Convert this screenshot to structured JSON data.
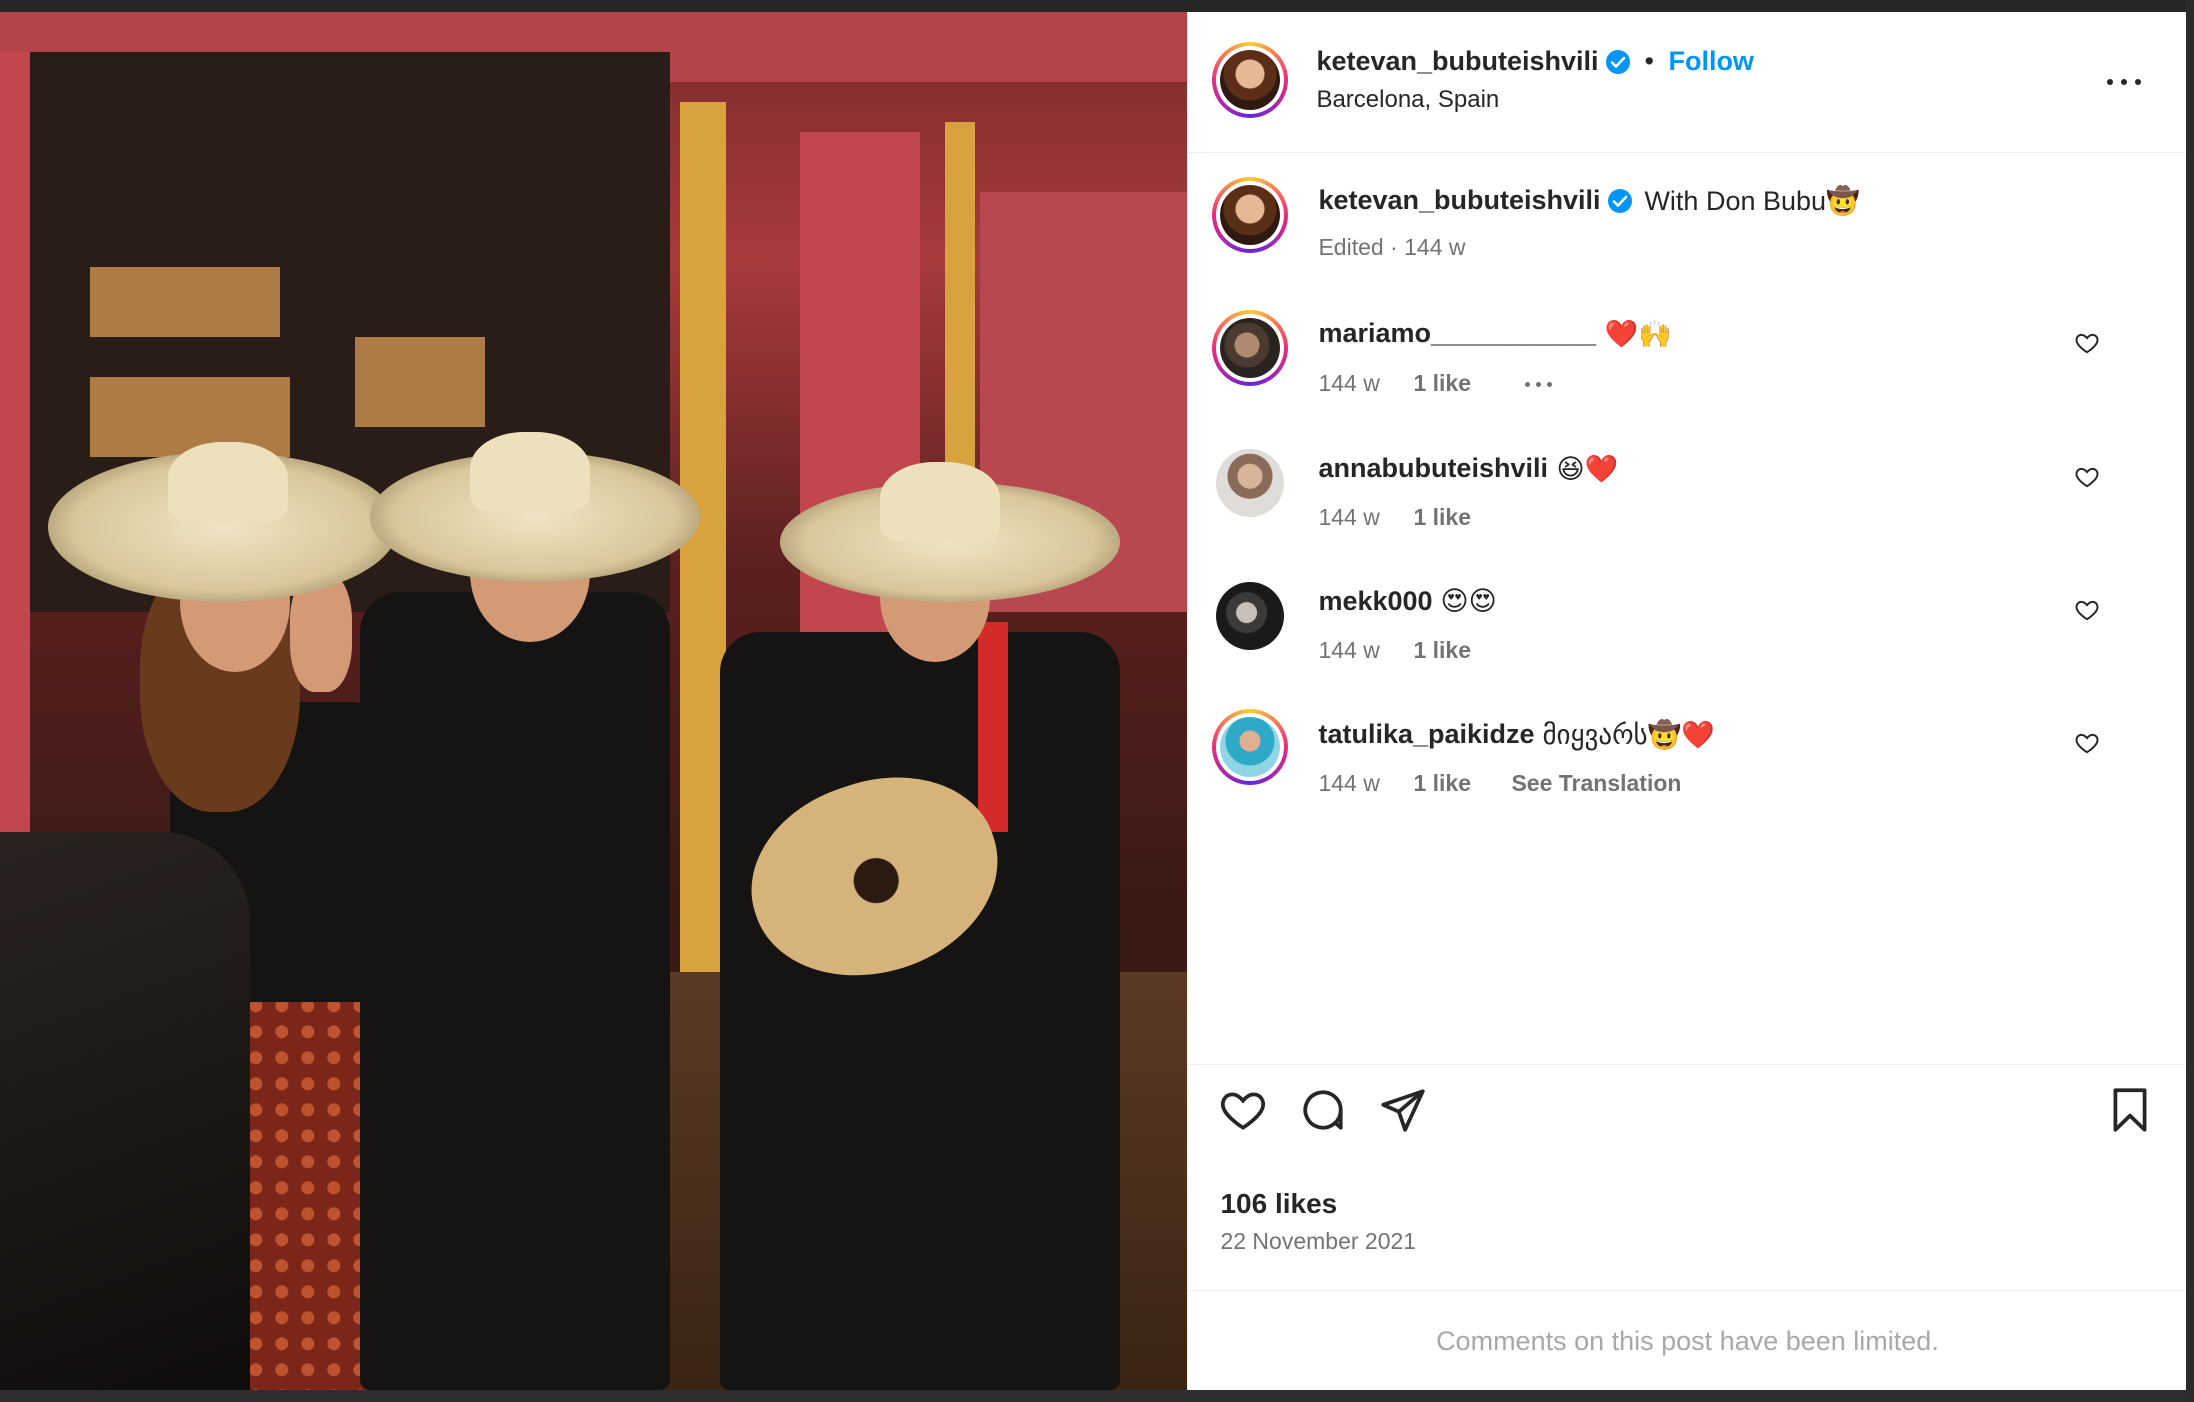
{
  "post": {
    "author": "ketevan_bubuteishvili",
    "follow_label": "Follow",
    "separator": "•",
    "location": "Barcelona, Spain",
    "photo_alt": "Three people in sombreros, one holding a guitar"
  },
  "caption": {
    "author": "ketevan_bubuteishvili",
    "text": "With Don Bubu🤠",
    "meta": "Edited · 144 w"
  },
  "comments": [
    {
      "user": "mariamo___________",
      "text": "❤️🙌",
      "age": "144 w",
      "likes": "1 like",
      "extra": ""
    },
    {
      "user": "annabubuteishvili",
      "text": "😆❤️",
      "age": "144 w",
      "likes": "1 like",
      "extra": ""
    },
    {
      "user": "mekk000",
      "text": "😍😍",
      "age": "144 w",
      "likes": "1 like",
      "extra": ""
    },
    {
      "user": "tatulika_paikidze",
      "text": "მიყვარს🤠❤️",
      "age": "144 w",
      "likes": "1 like",
      "extra": "See Translation"
    }
  ],
  "footer": {
    "likes": "106 likes",
    "date": "22 November 2021",
    "comments_limited": "Comments on this post have been limited."
  },
  "colors": {
    "link": "#0095f6",
    "text": "#262626",
    "muted": "#737373"
  }
}
